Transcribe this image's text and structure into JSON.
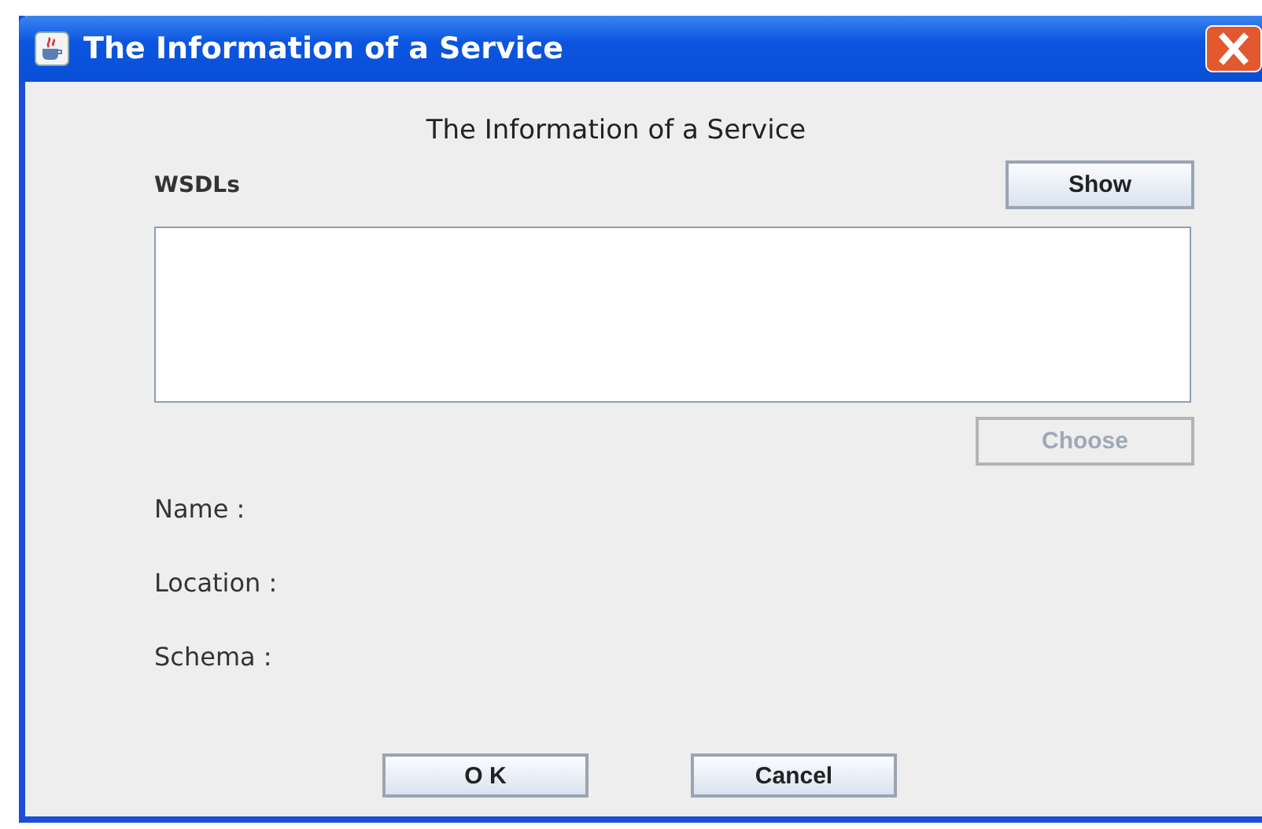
{
  "window": {
    "title": "The Information of a Service"
  },
  "heading": "The Information of a Service",
  "wsdls": {
    "label": "WSDLs",
    "show_button": {
      "label": "Show",
      "disabled": false
    },
    "choose_button": {
      "label": "Choose",
      "disabled": true
    }
  },
  "fields": [
    {
      "label": "Name :"
    },
    {
      "label": "Location :"
    },
    {
      "label": "Schema :"
    }
  ],
  "buttons": [
    {
      "label": "O K",
      "disabled": false
    },
    {
      "label": "Cancel",
      "disabled": false
    }
  ]
}
